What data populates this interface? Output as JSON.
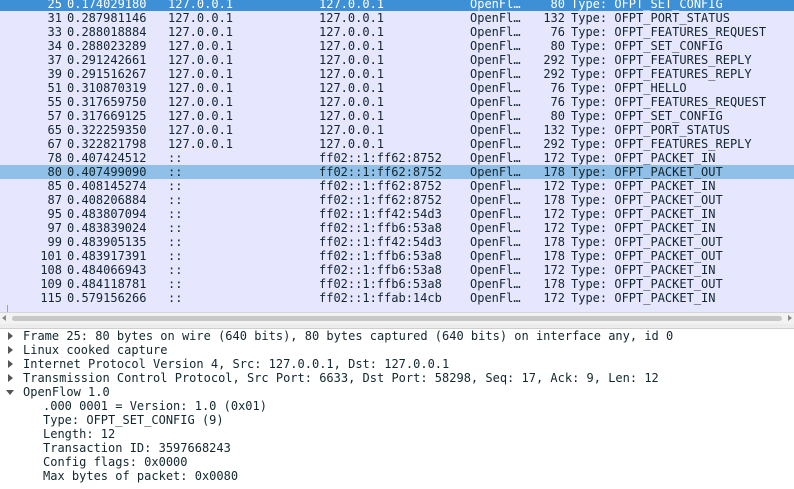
{
  "colors": {
    "list_background": "#e7e6ff",
    "selected_row": "#3d8fd6",
    "related_row": "#90bfe8",
    "text": "#12272e"
  },
  "packet_list": {
    "rows": [
      {
        "no": "25",
        "time": "0.174029180",
        "source": "127.0.0.1",
        "destination": "127.0.0.1",
        "protocol": "OpenFl…",
        "length": "80",
        "info": "Type: OFPT_SET_CONFIG",
        "state": "selected"
      },
      {
        "no": "31",
        "time": "0.287981146",
        "source": "127.0.0.1",
        "destination": "127.0.0.1",
        "protocol": "OpenFl…",
        "length": "132",
        "info": "Type: OFPT_PORT_STATUS",
        "state": "normal"
      },
      {
        "no": "33",
        "time": "0.288018884",
        "source": "127.0.0.1",
        "destination": "127.0.0.1",
        "protocol": "OpenFl…",
        "length": "76",
        "info": "Type: OFPT_FEATURES_REQUEST",
        "state": "normal"
      },
      {
        "no": "34",
        "time": "0.288023289",
        "source": "127.0.0.1",
        "destination": "127.0.0.1",
        "protocol": "OpenFl…",
        "length": "80",
        "info": "Type: OFPT_SET_CONFIG",
        "state": "normal"
      },
      {
        "no": "37",
        "time": "0.291242661",
        "source": "127.0.0.1",
        "destination": "127.0.0.1",
        "protocol": "OpenFl…",
        "length": "292",
        "info": "Type: OFPT_FEATURES_REPLY",
        "state": "normal"
      },
      {
        "no": "39",
        "time": "0.291516267",
        "source": "127.0.0.1",
        "destination": "127.0.0.1",
        "protocol": "OpenFl…",
        "length": "292",
        "info": "Type: OFPT_FEATURES_REPLY",
        "state": "normal"
      },
      {
        "no": "51",
        "time": "0.310870319",
        "source": "127.0.0.1",
        "destination": "127.0.0.1",
        "protocol": "OpenFl…",
        "length": "76",
        "info": "Type: OFPT_HELLO",
        "state": "normal"
      },
      {
        "no": "55",
        "time": "0.317659750",
        "source": "127.0.0.1",
        "destination": "127.0.0.1",
        "protocol": "OpenFl…",
        "length": "76",
        "info": "Type: OFPT_FEATURES_REQUEST",
        "state": "normal"
      },
      {
        "no": "57",
        "time": "0.317669125",
        "source": "127.0.0.1",
        "destination": "127.0.0.1",
        "protocol": "OpenFl…",
        "length": "80",
        "info": "Type: OFPT_SET_CONFIG",
        "state": "normal"
      },
      {
        "no": "65",
        "time": "0.322259350",
        "source": "127.0.0.1",
        "destination": "127.0.0.1",
        "protocol": "OpenFl…",
        "length": "132",
        "info": "Type: OFPT_PORT_STATUS",
        "state": "normal"
      },
      {
        "no": "67",
        "time": "0.322821798",
        "source": "127.0.0.1",
        "destination": "127.0.0.1",
        "protocol": "OpenFl…",
        "length": "292",
        "info": "Type: OFPT_FEATURES_REPLY",
        "state": "normal"
      },
      {
        "no": "78",
        "time": "0.407424512",
        "source": "::",
        "destination": "ff02::1:ff62:8752",
        "protocol": "OpenFl…",
        "length": "172",
        "info": "Type: OFPT_PACKET_IN",
        "state": "normal"
      },
      {
        "no": "80",
        "time": "0.407499090",
        "source": "::",
        "destination": "ff02::1:ff62:8752",
        "protocol": "OpenFl…",
        "length": "178",
        "info": "Type: OFPT_PACKET_OUT",
        "state": "related"
      },
      {
        "no": "85",
        "time": "0.408145274",
        "source": "::",
        "destination": "ff02::1:ff62:8752",
        "protocol": "OpenFl…",
        "length": "172",
        "info": "Type: OFPT_PACKET_IN",
        "state": "normal"
      },
      {
        "no": "87",
        "time": "0.408206884",
        "source": "::",
        "destination": "ff02::1:ff62:8752",
        "protocol": "OpenFl…",
        "length": "178",
        "info": "Type: OFPT_PACKET_OUT",
        "state": "normal"
      },
      {
        "no": "95",
        "time": "0.483807094",
        "source": "::",
        "destination": "ff02::1:ff42:54d3",
        "protocol": "OpenFl…",
        "length": "172",
        "info": "Type: OFPT_PACKET_IN",
        "state": "normal"
      },
      {
        "no": "97",
        "time": "0.483839024",
        "source": "::",
        "destination": "ff02::1:ffb6:53a8",
        "protocol": "OpenFl…",
        "length": "172",
        "info": "Type: OFPT_PACKET_IN",
        "state": "normal"
      },
      {
        "no": "99",
        "time": "0.483905135",
        "source": "::",
        "destination": "ff02::1:ff42:54d3",
        "protocol": "OpenFl…",
        "length": "178",
        "info": "Type: OFPT_PACKET_OUT",
        "state": "normal"
      },
      {
        "no": "101",
        "time": "0.483917391",
        "source": "::",
        "destination": "ff02::1:ffb6:53a8",
        "protocol": "OpenFl…",
        "length": "178",
        "info": "Type: OFPT_PACKET_OUT",
        "state": "normal"
      },
      {
        "no": "108",
        "time": "0.484066943",
        "source": "::",
        "destination": "ff02::1:ffb6:53a8",
        "protocol": "OpenFl…",
        "length": "172",
        "info": "Type: OFPT_PACKET_IN",
        "state": "normal"
      },
      {
        "no": "109",
        "time": "0.484118781",
        "source": "::",
        "destination": "ff02::1:ffb6:53a8",
        "protocol": "OpenFl…",
        "length": "178",
        "info": "Type: OFPT_PACKET_OUT",
        "state": "normal"
      },
      {
        "no": "115",
        "time": "0.579156266",
        "source": "::",
        "destination": "ff02::1:ffab:14cb",
        "protocol": "OpenFl…",
        "length": "172",
        "info": "Type: OFPT_PACKET_IN",
        "state": "normal"
      }
    ]
  },
  "packet_details": {
    "items": [
      {
        "label": "Frame 25: 80 bytes on wire (640 bits), 80 bytes captured (640 bits) on interface any, id 0",
        "expander": "closed",
        "level": 0
      },
      {
        "label": "Linux cooked capture",
        "expander": "closed",
        "level": 0
      },
      {
        "label": "Internet Protocol Version 4, Src: 127.0.0.1, Dst: 127.0.0.1",
        "expander": "closed",
        "level": 0
      },
      {
        "label": "Transmission Control Protocol, Src Port: 6633, Dst Port: 58298, Seq: 17, Ack: 9, Len: 12",
        "expander": "closed",
        "level": 0
      },
      {
        "label": "OpenFlow 1.0",
        "expander": "open",
        "level": 0
      },
      {
        "label": ".000 0001 = Version: 1.0 (0x01)",
        "expander": "none",
        "level": 1
      },
      {
        "label": "Type: OFPT_SET_CONFIG (9)",
        "expander": "none",
        "level": 1
      },
      {
        "label": "Length: 12",
        "expander": "none",
        "level": 1
      },
      {
        "label": "Transaction ID: 3597668243",
        "expander": "none",
        "level": 1
      },
      {
        "label": "Config flags: 0x0000",
        "expander": "none",
        "level": 1
      },
      {
        "label": "Max bytes of packet: 0x0080",
        "expander": "none",
        "level": 1
      }
    ]
  },
  "icons": {
    "expander_closed": "triangle-right-icon",
    "expander_open": "triangle-down-icon",
    "scroll_left": "arrow-left-icon",
    "scroll_right": "arrow-right-icon"
  }
}
